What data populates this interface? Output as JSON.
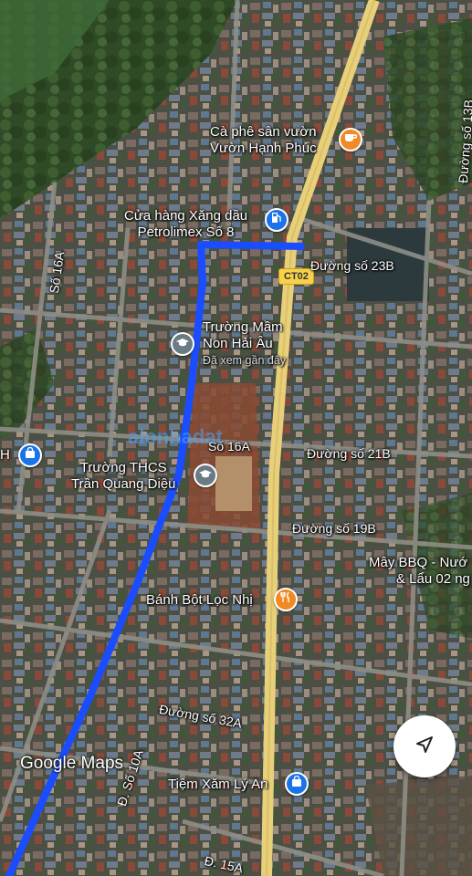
{
  "map": {
    "pois": {
      "cafe": {
        "line1": "Cà phê sân vườn",
        "line2": "Vườn Hạnh Phúc",
        "icon": "coffee-cup-icon"
      },
      "gas": {
        "line1": "Cửa hàng Xăng dầu",
        "line2": "Petrolimex Số 8",
        "icon": "gas-station-icon"
      },
      "kindergarten": {
        "line1": "Trường Mầm",
        "line2": "Non Hải Âu",
        "note": "Đã xem gần đây",
        "icon": "graduation-cap-icon"
      },
      "school": {
        "line1": "Trường THCS",
        "line2": "Trần Quang Diệu",
        "icon": "graduation-cap-icon"
      },
      "bbq": {
        "line1": "Mây BBQ - Nướ",
        "line2": "& Lẩu 02 ng",
        "icon": ""
      },
      "restaurant": {
        "label": "Bánh Bột Lọc Nhị",
        "icon": "fork-knife-icon"
      },
      "tattoo": {
        "label": "Tiệm Xăm Lý An",
        "icon": "shopping-bag-icon"
      },
      "left_shop": {
        "label": "H",
        "icon": "shopping-bag-icon"
      }
    },
    "roads": {
      "r23b": "Đường số 23B",
      "r21b": "Đường số 21B",
      "r19b": "Đường số 19B",
      "r32a": "Đường số 32A",
      "r16a_left": "Số 16A",
      "r16a_mid": "Số 16A",
      "r10a": "Đ. Số 10A",
      "r15a": "Đ. 15A",
      "r13b": "Đường số 13B",
      "ct02": "CT02"
    },
    "watermark": "alonhadat",
    "attribution": "Google Maps"
  },
  "controls": {
    "locate_icon": "navigation-arrow-icon"
  },
  "colors": {
    "route": "#1a4dff",
    "highway": "#e8d07a",
    "poi_orange": "#f08a24",
    "poi_blue": "#1a73e8",
    "poi_gray": "#6b7b86"
  }
}
